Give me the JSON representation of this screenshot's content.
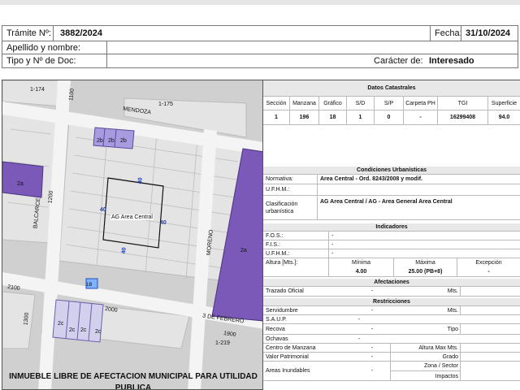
{
  "header": {
    "tramite_label": "Trámite Nº:",
    "tramite_value": "3882/2024",
    "fecha_label": "Fecha:",
    "fecha_value": "31/10/2024",
    "apellido_label": "Apellido y nombre:",
    "tipo_doc_label": "Tipo y Nº de Doc:",
    "caracter_label": "Carácter de:",
    "caracter_value": "Interesado"
  },
  "map": {
    "streets": [
      "MENDOZA",
      "BALCARCE",
      "MORENO",
      "3 DE FEBRERO",
      "2000",
      "1900",
      "2100",
      "1300",
      "1200",
      "1100"
    ],
    "block_numbers": [
      "1-174",
      "1-175",
      "1-219"
    ],
    "zones": [
      "2b",
      "2b",
      "2b",
      "2a",
      "2a",
      "2c",
      "2c",
      "2c",
      "2c",
      "1B"
    ],
    "area_label": "AG Area Central",
    "dims": [
      "40",
      "40",
      "40",
      "40"
    ],
    "footer": "INMUEBLE LIBRE DE AFECTACION MUNICIPAL PARA UTILIDAD PUBLICA"
  },
  "catastro": {
    "title": "Datos Catastrales",
    "headers": [
      "Sección",
      "Manzana",
      "Gráfico",
      "S/D",
      "S/P",
      "Carpeta PH",
      "TGI",
      "Superficie"
    ],
    "values": [
      "1",
      "196",
      "18",
      "1",
      "0",
      "-",
      "16299408",
      "94.0"
    ]
  },
  "urbanisticas": {
    "title": "Condiciones Urbanísticas",
    "normativa_label": "Normativa:",
    "normativa_value": "Area Central - Ord. 8243/2008 y modif.",
    "ufhm_label": "U.F.H.M.:",
    "clasif_label_1": "Clasificación",
    "clasif_label_2": "urbanística",
    "clasif_value": "AG Area Central / AG - Area General Area Central"
  },
  "indicadores": {
    "title": "Indicadores",
    "fos_label": "F.O.S.:",
    "fos_value": "-",
    "fis_label": "F.I.S.:",
    "fis_value": "-",
    "ufhm_label": "U.F.H.M.:",
    "ufhm_value": "-",
    "altura_label": "Altura [Mts.]:",
    "minima_label": "Mínima",
    "maxima_label": "Máxima",
    "excepcion_label": "Excepción",
    "minima_value": "4.00",
    "maxima_value": "25.00 (PB+8)",
    "excepcion_value": "-"
  },
  "afectaciones": {
    "title": "Afectaciones",
    "trazado_label": "Trazado Oficial",
    "trazado_value": "-",
    "mts_label": "Mts."
  },
  "restricciones": {
    "title": "Restricciones",
    "servidumbre_label": "Servidumbre",
    "servidumbre_value": "-",
    "servidumbre_unit": "Mts.",
    "saup_label": "S.A.U.P.",
    "saup_value": "-",
    "recova_label": "Recova",
    "recova_value": "-",
    "tipo_label": "Tipo",
    "ochavas_label": "Ochavas",
    "ochavas_value": "-",
    "centro_label": "Centro de Manzana",
    "centro_value": "-",
    "altura_max_label": "Altura Max Mts.",
    "valor_label": "Valor Patrimonial",
    "valor_value": "-",
    "grado_label": "Grado",
    "areas_label": "Areas Inundables",
    "areas_value": "-",
    "zona_label": "Zona / Sector",
    "impactos_label": "Impactos"
  }
}
